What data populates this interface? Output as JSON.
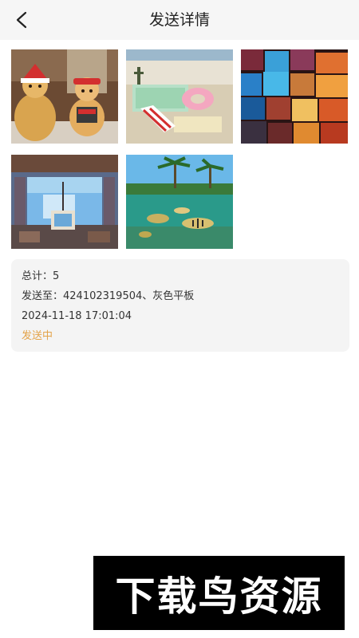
{
  "header": {
    "title": "发送详情",
    "back_icon": "chevron-left-icon"
  },
  "photos": [
    {
      "name": "teddy-bears-christmas"
    },
    {
      "name": "beach-pool-float"
    },
    {
      "name": "colorful-cubes"
    },
    {
      "name": "anime-room-painting"
    },
    {
      "name": "tropical-underwater-fish"
    }
  ],
  "info": {
    "total": "总计：5",
    "send_to": "发送至：424102319504、灰色平板",
    "datetime": "2024-11-18 17:01:04",
    "status": "发送中",
    "status_color": "#e3a349"
  },
  "watermark": {
    "text": "下载鸟资源"
  }
}
